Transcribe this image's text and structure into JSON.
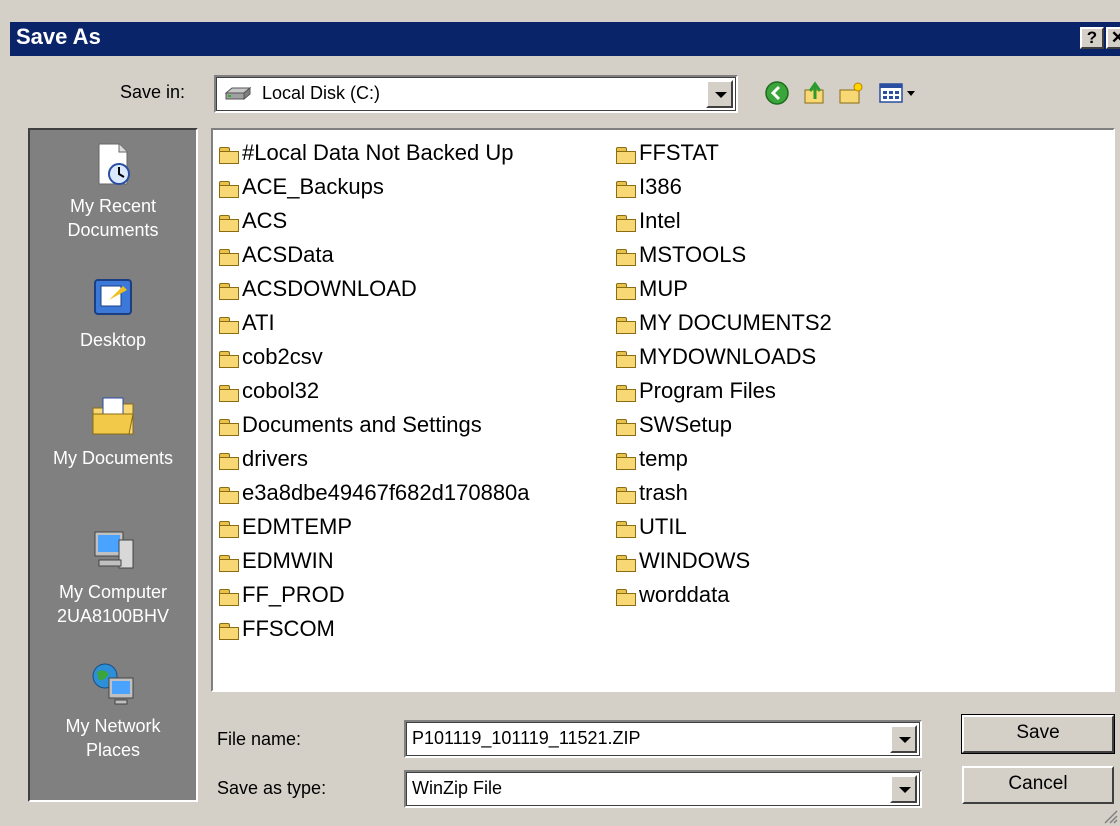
{
  "window": {
    "title": "Save As",
    "help_label": "?",
    "close_label": "✕"
  },
  "save_in": {
    "label": "Save in:",
    "value": "Local Disk (C:)",
    "drive_icon": "hard-drive-icon"
  },
  "toolbar": {
    "icons": [
      "back-icon",
      "up-folder-icon",
      "new-folder-icon",
      "view-menu-icon"
    ]
  },
  "places": [
    {
      "label_line1": "My Recent",
      "label_line2": "Documents",
      "icon": "recent-documents-icon"
    },
    {
      "label_line1": "Desktop",
      "label_line2": "",
      "icon": "desktop-icon"
    },
    {
      "label_line1": "My Documents",
      "label_line2": "",
      "icon": "my-documents-icon"
    },
    {
      "label_line1": "My Computer",
      "label_line2": "2UA8100BHV",
      "icon": "my-computer-icon"
    },
    {
      "label_line1": "My Network",
      "label_line2": "Places",
      "icon": "network-places-icon"
    }
  ],
  "folders_col1": [
    "#Local Data Not Backed Up",
    "ACE_Backups",
    "ACS",
    "ACSData",
    "ACSDOWNLOAD",
    "ATI",
    "cob2csv",
    "cobol32",
    "Documents and Settings",
    "drivers",
    "e3a8dbe49467f682d170880a",
    "EDMTEMP",
    "EDMWIN",
    "FF_PROD",
    "FFSCOM"
  ],
  "folders_col2": [
    "FFSTAT",
    "I386",
    "Intel",
    "MSTOOLS",
    "MUP",
    "MY DOCUMENTS2",
    "MYDOWNLOADS",
    "Program Files",
    "SWSetup",
    "temp",
    "trash",
    "UTIL",
    "WINDOWS",
    "worddata"
  ],
  "file_name": {
    "label": "File name:",
    "value": "P101119_101119_11521.ZIP"
  },
  "save_type": {
    "label": "Save as type:",
    "value": "WinZip File"
  },
  "buttons": {
    "save": "Save",
    "cancel": "Cancel"
  }
}
